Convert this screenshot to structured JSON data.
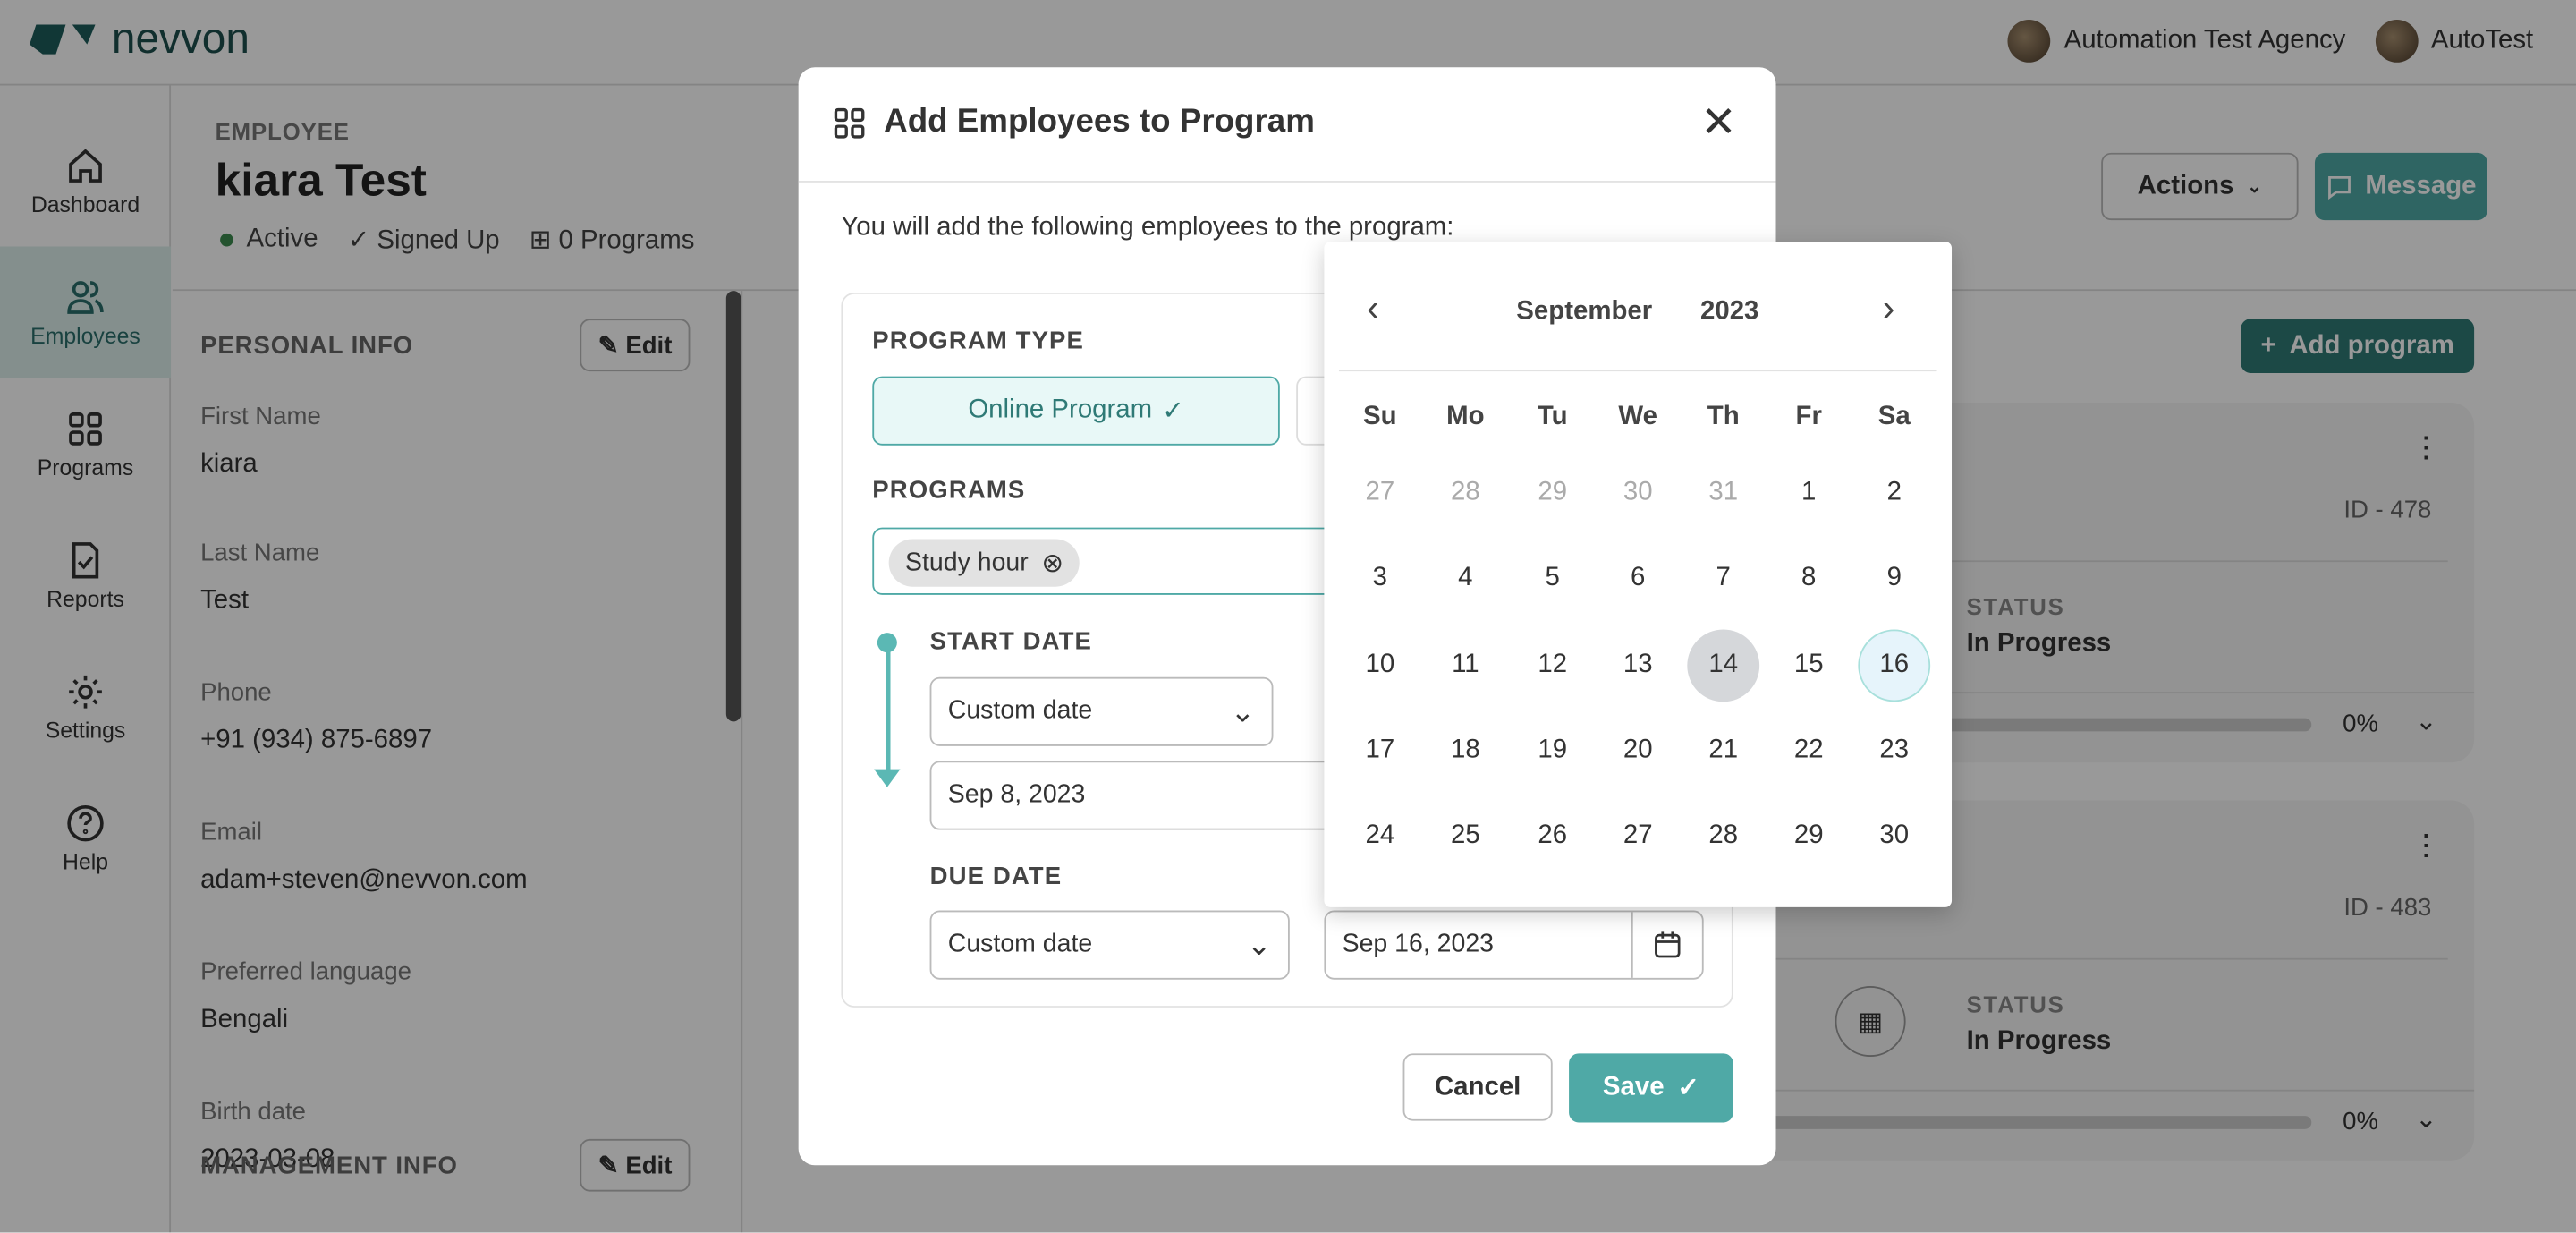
{
  "header": {
    "brand": "nevvon",
    "org": "Automation Test Agency",
    "user": "AutoTest"
  },
  "sidebar": {
    "items": [
      {
        "label": "Dashboard",
        "icon": "home-icon"
      },
      {
        "label": "Employees",
        "icon": "users-icon",
        "active": true
      },
      {
        "label": "Programs",
        "icon": "grid-icon"
      },
      {
        "label": "Reports",
        "icon": "report-icon"
      },
      {
        "label": "Settings",
        "icon": "gear-icon"
      },
      {
        "label": "Help",
        "icon": "help-icon"
      }
    ]
  },
  "employee": {
    "label": "EMPLOYEE",
    "name": "kiara Test",
    "status": "Active",
    "signup": "Signed Up",
    "programs": "0 Programs"
  },
  "actions": {
    "actions_label": "Actions",
    "message_label": "Message",
    "add_program_label": "Add program"
  },
  "personal_info": {
    "title": "PERSONAL INFO",
    "edit": "Edit",
    "fields": [
      {
        "label": "First Name",
        "value": "kiara"
      },
      {
        "label": "Last Name",
        "value": "Test"
      },
      {
        "label": "Phone",
        "value": "+91 (934) 875-6897"
      },
      {
        "label": "Email",
        "value": "adam+steven@nevvon.com"
      },
      {
        "label": "Preferred language",
        "value": "Bengali"
      },
      {
        "label": "Birth date",
        "value": "2023-03-08"
      }
    ]
  },
  "management_info": {
    "title": "MANAGEMENT INFO",
    "edit": "Edit"
  },
  "cards": [
    {
      "id": "ID - 478",
      "status_label": "STATUS",
      "status": "In Progress",
      "progress": "0%"
    },
    {
      "id": "ID - 483",
      "status_label": "STATUS",
      "status": "In Progress",
      "progress": "0%"
    }
  ],
  "modal": {
    "title": "Add Employees to Program",
    "intro": "You will add the following employees to the program:",
    "program_type_label": "PROGRAM TYPE",
    "program_type_selected": "Online Program",
    "programs_label": "PROGRAMS",
    "program_chip": "Study hour",
    "start_date_label": "START DATE",
    "start_mode": "Custom date",
    "start_date": "Sep 8, 2023",
    "due_date_label": "DUE DATE",
    "due_mode": "Custom date",
    "due_date": "Sep 16, 2023",
    "cancel": "Cancel",
    "save": "Save"
  },
  "calendar": {
    "month": "September",
    "year": "2023",
    "weekdays": [
      "Su",
      "Mo",
      "Tu",
      "We",
      "Th",
      "Fr",
      "Sa"
    ],
    "weeks": [
      [
        "27",
        "28",
        "29",
        "30",
        "31",
        "1",
        "2"
      ],
      [
        "3",
        "4",
        "5",
        "6",
        "7",
        "8",
        "9"
      ],
      [
        "10",
        "11",
        "12",
        "13",
        "14",
        "15",
        "16"
      ],
      [
        "17",
        "18",
        "19",
        "20",
        "21",
        "22",
        "23"
      ],
      [
        "24",
        "25",
        "26",
        "27",
        "28",
        "29",
        "30"
      ]
    ],
    "today": "14",
    "selected": "16",
    "accent": "#4fa9a6"
  }
}
